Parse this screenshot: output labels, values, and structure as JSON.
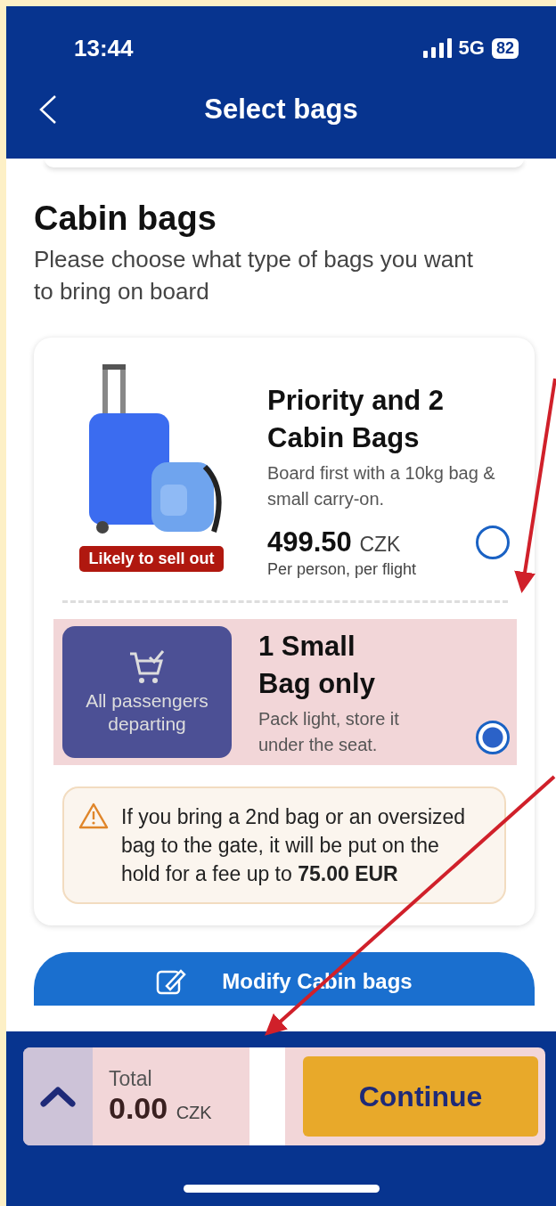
{
  "status_bar": {
    "time": "13:44",
    "network": "5G",
    "battery": "82"
  },
  "header": {
    "title": "Select bags"
  },
  "section": {
    "title": "Cabin bags",
    "subtitle": "Please choose what type of bags you want to bring on board"
  },
  "options": [
    {
      "kind": "image",
      "badge": "Likely to sell out",
      "title": "Priority and 2 Cabin Bags",
      "description": "Board first with a 10kg bag & small carry-on.",
      "price": "499.50",
      "currency": "CZK",
      "price_note": "Per person, per flight",
      "selected": false,
      "highlighted": false
    },
    {
      "kind": "tile",
      "tile_text": "All passengers departing",
      "title": "1 Small Bag only",
      "description": "Pack light, store it under the seat.",
      "selected": true,
      "highlighted": true
    }
  ],
  "warning": {
    "text": "If you bring a 2nd bag or an oversized bag to the gate, it will be put on the hold for a fee up to **75.00 EUR**"
  },
  "modify_button": "Modify Cabin bags",
  "footer": {
    "total_label": "Total",
    "total": "0.00",
    "currency": "CZK",
    "continue": "Continue",
    "highlighted": true
  }
}
